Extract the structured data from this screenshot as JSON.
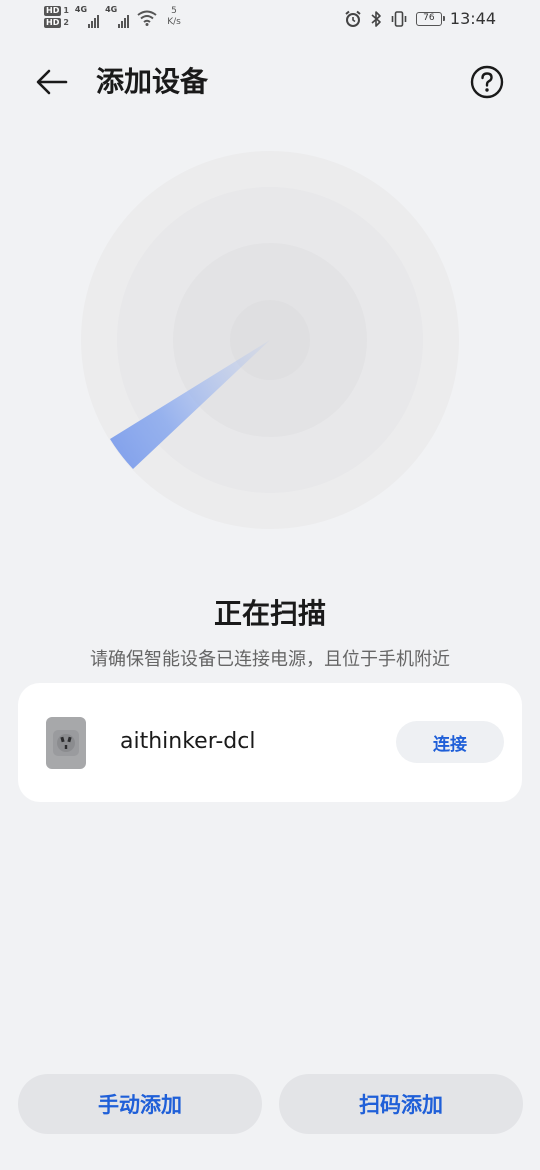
{
  "status_bar": {
    "sim1_tag": "HD",
    "sim1_num": "1",
    "sim2_tag": "HD",
    "sim2_num": "2",
    "net1": "4G",
    "net2": "4G",
    "speed_value": "5",
    "speed_unit": "K/s",
    "battery_level": "76",
    "time": "13:44",
    "icons": [
      "signal-icon",
      "wifi-icon",
      "alarm-icon",
      "bluetooth-icon",
      "vibrate-icon",
      "battery-icon"
    ]
  },
  "header": {
    "title": "添加设备",
    "back_icon": "arrow-left-icon",
    "help_icon": "question-circle-icon"
  },
  "scan": {
    "title": "正在扫描",
    "hint": "请确保智能设备已连接电源，且位于手机附近"
  },
  "device": {
    "name": "aithinker-dcl",
    "icon": "smart-plug-icon",
    "connect_label": "连接"
  },
  "actions": {
    "manual_add": "手动添加",
    "scan_add": "扫码添加"
  },
  "colors": {
    "background": "#f1f2f4",
    "card": "#ffffff",
    "accent": "#1f5fd8",
    "radar_beam": "#8aaaf0"
  }
}
